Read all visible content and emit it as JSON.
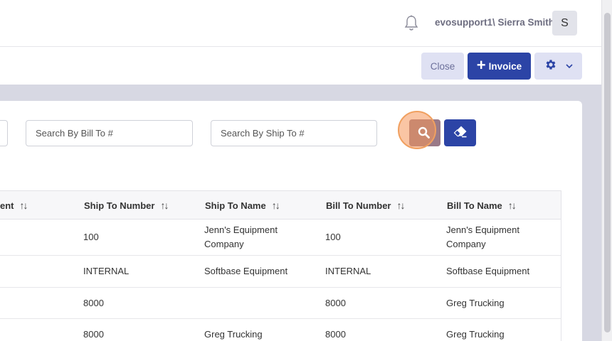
{
  "header": {
    "user_label": "evosupport1\\ Sierra Smith",
    "avatar_initial": "S"
  },
  "toolbar": {
    "close_label": "Close",
    "invoice_label": "Invoice"
  },
  "filters": {
    "bill_to_placeholder": "Search By Bill To #",
    "ship_to_placeholder": "Search By Ship To #"
  },
  "table": {
    "columns": [
      "ent",
      "Ship To Number",
      "Ship To Name",
      "Bill To Number",
      "Bill To Name"
    ],
    "rows": [
      [
        "100",
        "Jenn's Equipment Company",
        "100",
        "Jenn's Equipment Company"
      ],
      [
        "INTERNAL",
        "Softbase Equipment",
        "INTERNAL",
        "Softbase Equipment"
      ],
      [
        "8000",
        "",
        "8000",
        "Greg Trucking"
      ],
      [
        "8000",
        "Greg Trucking",
        "8000",
        "Greg Trucking"
      ]
    ]
  },
  "colors": {
    "primary": "#2c44a6",
    "secondary_bg": "#dfe1f3",
    "page_bg": "#d7d8e3",
    "search_active": "#9a7a88"
  }
}
